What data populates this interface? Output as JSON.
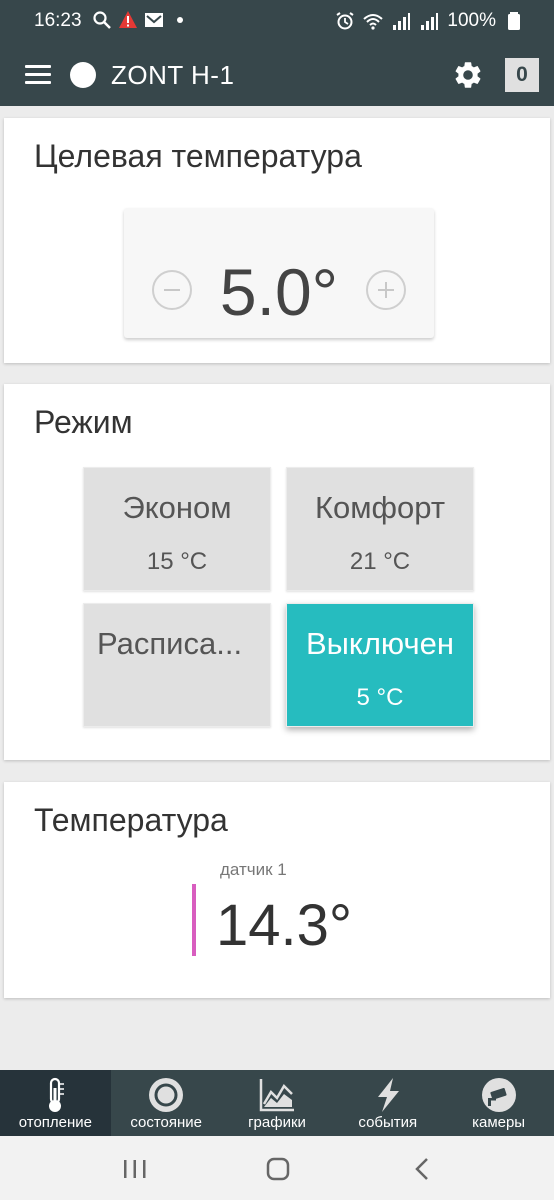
{
  "status_bar": {
    "time": "16:23",
    "battery": "100%",
    "icons": [
      "search-icon",
      "warning-icon",
      "mail-icon",
      "dot-icon",
      "alarm-icon",
      "wifi-icon",
      "signal-icon",
      "signal-2-icon",
      "battery-icon"
    ]
  },
  "app_bar": {
    "title": "ZONT H-1",
    "badge": "0"
  },
  "target_temperature": {
    "title": "Целевая температура",
    "value": "5.0°"
  },
  "mode": {
    "title": "Режим",
    "tiles": [
      {
        "name": "Эконом",
        "temp": "15 °C"
      },
      {
        "name": "Комфорт",
        "temp": "21 °C"
      },
      {
        "name": "Расписа...",
        "temp": ""
      },
      {
        "name": "Выключен",
        "temp": "5 °C"
      }
    ],
    "active_color": "#26bcbf"
  },
  "temperature": {
    "title": "Температура",
    "sensor_name": "датчик 1",
    "sensor_value": "14.3°",
    "sensor_color": "#d85dbf"
  },
  "bottom_nav": [
    {
      "label": "отопление",
      "icon": "thermometer-icon"
    },
    {
      "label": "состояние",
      "icon": "status-circle-icon"
    },
    {
      "label": "графики",
      "icon": "chart-icon"
    },
    {
      "label": "события",
      "icon": "lightning-icon"
    },
    {
      "label": "камеры",
      "icon": "camera-icon"
    }
  ],
  "colors": {
    "header": "#37474b",
    "accent": "#26bcbf"
  }
}
